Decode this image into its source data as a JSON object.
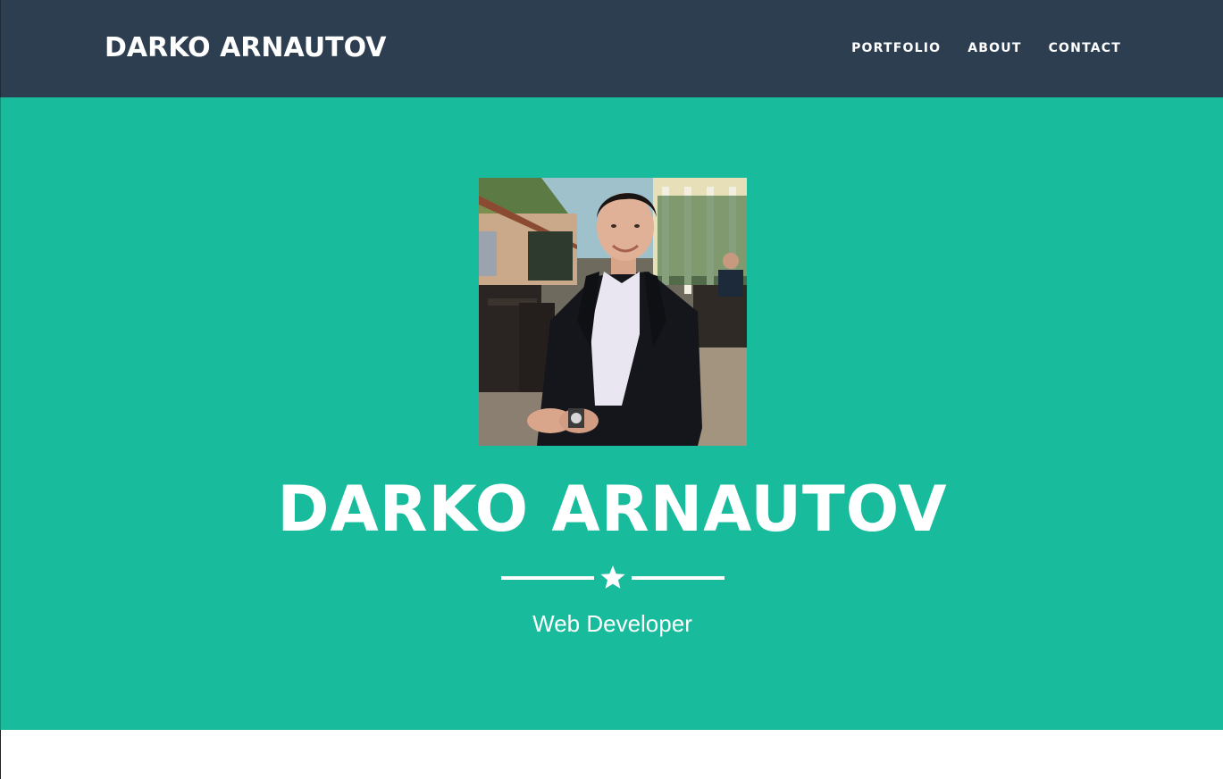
{
  "navbar": {
    "brand": "DARKO ARNAUTOV",
    "links": [
      {
        "label": "PORTFOLIO"
      },
      {
        "label": "ABOUT"
      },
      {
        "label": "CONTACT"
      }
    ]
  },
  "hero": {
    "profile_image_alt": "profile-photo",
    "title": "DARKO ARNAUTOV",
    "divider_icon": "star-icon",
    "subtitle": "Web Developer"
  },
  "colors": {
    "navbar_bg": "#2c3e50",
    "hero_bg": "#18bc9c",
    "text": "#ffffff"
  }
}
